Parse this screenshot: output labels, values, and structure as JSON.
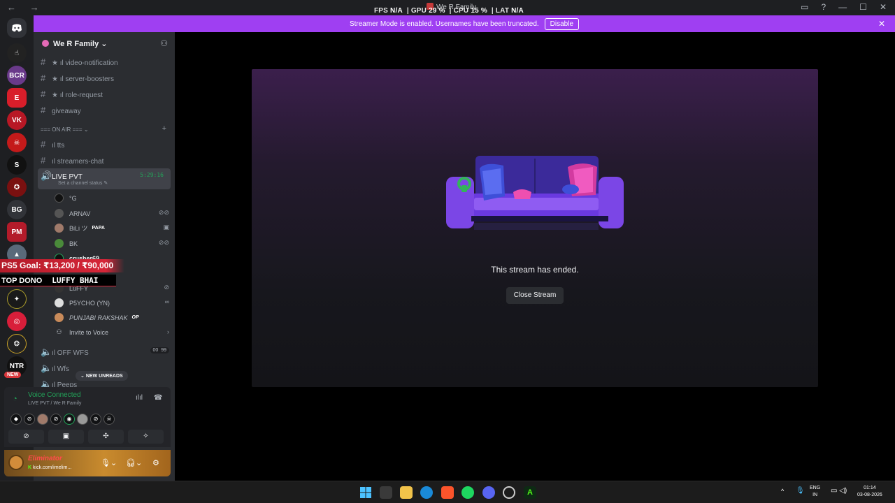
{
  "titlebar": {
    "window_title": "We R Family",
    "nav": "← →"
  },
  "perf": {
    "fps_label": "FPS",
    "fps": "N/A",
    "gpu_label": "GPU",
    "gpu": "29 %",
    "cpu_label": "CPU",
    "cpu": "15 %",
    "lat_label": "LAT",
    "lat": "N/A"
  },
  "banner": {
    "text": "Streamer Mode is enabled. Usernames have been truncated.",
    "button": "Disable"
  },
  "server": {
    "name": "We R Family"
  },
  "channels": [
    {
      "name": "★ ıl video-notification"
    },
    {
      "name": "★ ıl server-boosters"
    },
    {
      "name": "★ ıl role-request"
    },
    {
      "name": "giveaway"
    }
  ],
  "category": {
    "name": "=== ON AIR ==="
  },
  "channels2": [
    {
      "name": "ıl tts"
    },
    {
      "name": "ıl streamers-chat"
    }
  ],
  "live": {
    "name": "LIVE PVT",
    "status": "Set a channel status",
    "timer": "5:29:16"
  },
  "voice_users": [
    {
      "name": "°G"
    },
    {
      "name": "ARNAV"
    },
    {
      "name": "BiLi ツ",
      "badge": "PAPA"
    },
    {
      "name": "BK"
    },
    {
      "name": "crusher69"
    },
    {
      "name": "LuFFY"
    },
    {
      "name": "P5YCHO (YN)"
    },
    {
      "name": "PUNJABI RAKSHAK",
      "badge": "OP"
    }
  ],
  "invite": "Invite to Voice",
  "voice_channels": [
    {
      "name": "ıl OFF WFS",
      "count": "00",
      "limit": "99"
    },
    {
      "name": "ıl Wfs"
    },
    {
      "name": "ıl Peeps"
    }
  ],
  "new_unreads": "NEW UNREADS",
  "overlay": {
    "goal": "PS5 Goal: ₹13,200 / ₹90,000",
    "top_dono_label": "TOP DONO",
    "top_dono_name": "LUFFY BHAI"
  },
  "voice_panel": {
    "title": "Voice Connected",
    "subtitle": "LIVE PVT / We R Family"
  },
  "user": {
    "name": "Eliminator",
    "status": "kick.com/imelim..."
  },
  "rail": {
    "bg_label": "BG",
    "ntr_label": "NTR",
    "new_label": "NEW"
  },
  "stream": {
    "message": "This stream has ended.",
    "close_button": "Close Stream"
  },
  "tray": {
    "lang1": "ENG",
    "lang2": "IN",
    "time": "01:14",
    "date": "03-08-2026"
  },
  "colors": {
    "banner": "#9f3ff2",
    "accent_green": "#23a55a",
    "sidebar": "#2b2d31",
    "rail": "#1e1f22"
  }
}
